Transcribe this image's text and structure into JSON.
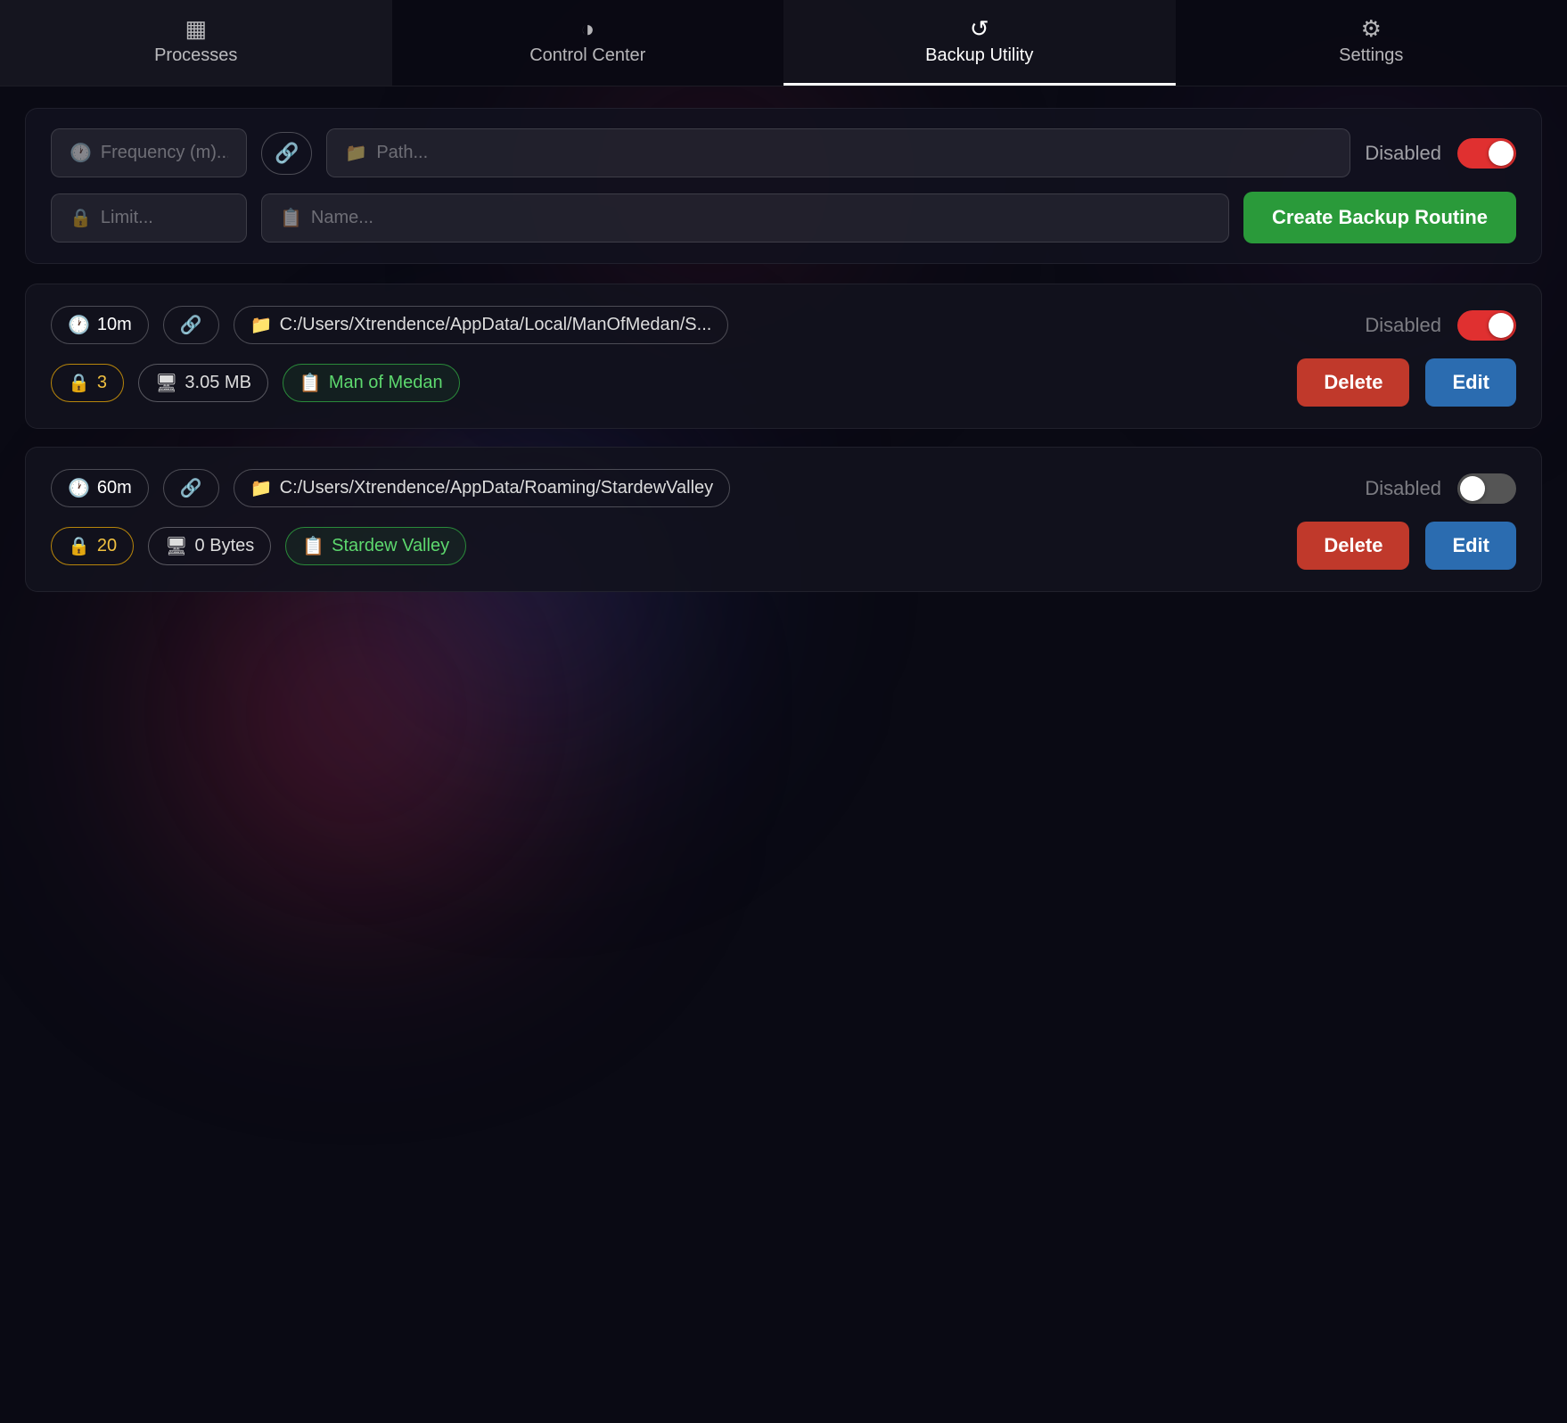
{
  "nav": {
    "items": [
      {
        "id": "processes",
        "label": "Processes",
        "icon": "▦",
        "active": false
      },
      {
        "id": "control-center",
        "label": "Control Center",
        "icon": "◑",
        "active": false
      },
      {
        "id": "backup-utility",
        "label": "Backup Utility",
        "icon": "↺",
        "active": true
      },
      {
        "id": "settings",
        "label": "Settings",
        "icon": "⚙",
        "active": false
      }
    ]
  },
  "form": {
    "frequency_placeholder": "Frequency (m)...",
    "path_placeholder": "Path...",
    "limit_placeholder": "Limit...",
    "name_placeholder": "Name...",
    "disabled_label": "Disabled",
    "toggle_state": "on",
    "create_button_label": "Create Backup Routine"
  },
  "routines": [
    {
      "id": "man-of-medan",
      "frequency": "10m",
      "path": "C:/Users/Xtrendence/AppData/Local/ManOfMedan/S...",
      "path_full": "C:/Users/Xtrendence/AppData/Local/ManOfMedan/s:",
      "limit": "3",
      "size": "3.05 MB",
      "name": "Man of Medan",
      "disabled_label": "Disabled",
      "toggle_state": "on",
      "delete_label": "Delete",
      "edit_label": "Edit"
    },
    {
      "id": "stardew-valley",
      "frequency": "60m",
      "path": "C:/Users/Xtrendence/AppData/Roaming/StardewValley",
      "path_full": "C:/Users/Xtrendence/AppData/Roaming/StardewValley",
      "limit": "20",
      "size": "0 Bytes",
      "name": "Stardew Valley",
      "disabled_label": "Disabled",
      "toggle_state": "off",
      "delete_label": "Delete",
      "edit_label": "Edit"
    }
  ]
}
